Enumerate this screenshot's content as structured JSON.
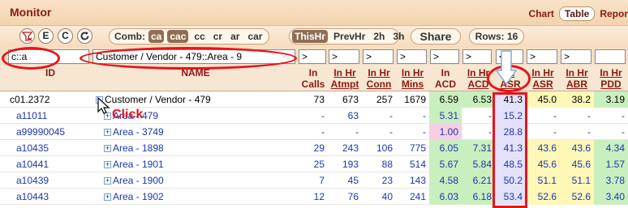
{
  "app": {
    "title": "Monitor",
    "links": [
      "Chart",
      "Table",
      "Repor"
    ]
  },
  "toolbar": {
    "icons": [
      "filter-clear-icon",
      "E",
      "C",
      "refresh-icon"
    ],
    "comb_label": "Comb:",
    "comb_options": [
      "ca",
      "cac",
      "cc",
      "cr",
      "ar",
      "car"
    ],
    "comb_selected": [
      "ca",
      "cac"
    ],
    "period_options": [
      "ThisHr",
      "PrevHr",
      "2h",
      "3h"
    ],
    "period_selected": "ThisHr",
    "share": "Share",
    "rows": "Rows: 16"
  },
  "filters": {
    "id": "c::a",
    "name": "Customer / Vendor - 479::Area - 9",
    "in_calls": ">",
    "in_hr_attempt": ">",
    "in_hr_conn": ">",
    "in_hr_mins": ">",
    "in_acd": ">",
    "in_hr_acd": ">",
    "in_asr": "<",
    "in_hr_asr": ">",
    "in_hr_abr": ">",
    "in_hr_pdd": ""
  },
  "columns": {
    "id": "ID",
    "name": "NAME",
    "in_calls": [
      "In",
      "Calls"
    ],
    "in_hr_attempt": [
      "In Hr",
      "Atmpt"
    ],
    "in_hr_conn": [
      "In Hr",
      "Conn"
    ],
    "in_hr_mins": [
      "In Hr",
      "Mins"
    ],
    "in_acd": [
      "In",
      "ACD"
    ],
    "in_hr_acd": [
      "In Hr",
      "ACD"
    ],
    "in_asr": [
      "In",
      "ASR"
    ],
    "in_hr_asr": [
      "In Hr",
      "ASR"
    ],
    "in_hr_abr": [
      "In Hr",
      "ABR"
    ],
    "in_hr_pdd": [
      "In Hr",
      "PDD"
    ]
  },
  "annotation": {
    "click": "Click"
  },
  "rows": [
    {
      "id": "c01.2372",
      "name": "Customer / Vendor - 479",
      "calls": "73",
      "attempt": "673",
      "conn": "257",
      "mins": "1679",
      "acd": "6.59",
      "hracd": "6.53",
      "asr": "41.3",
      "hrasr": "45.0",
      "abr": "38.2",
      "pdd": "3.19"
    },
    {
      "id": "a11011",
      "name": "Area - 479",
      "calls": "-",
      "attempt": "63",
      "conn": "-",
      "mins": "-",
      "acd": "5.31",
      "hracd": "-",
      "asr": "15.2",
      "hrasr": "-",
      "abr": "-",
      "pdd": "-"
    },
    {
      "id": "a99990045",
      "name": "Area - 3749",
      "calls": "-",
      "attempt": "-",
      "conn": "-",
      "mins": "-",
      "acd": "1.00",
      "hracd": "-",
      "asr": "28.8",
      "hrasr": "-",
      "abr": "-",
      "pdd": "-"
    },
    {
      "id": "a10435",
      "name": "Area - 1898",
      "calls": "29",
      "attempt": "243",
      "conn": "106",
      "mins": "775",
      "acd": "6.05",
      "hracd": "7.31",
      "asr": "41.3",
      "hrasr": "43.6",
      "abr": "43.6",
      "pdd": "4.34"
    },
    {
      "id": "a10441",
      "name": "Area - 1901",
      "calls": "25",
      "attempt": "193",
      "conn": "88",
      "mins": "514",
      "acd": "5.67",
      "hracd": "5.84",
      "asr": "48.5",
      "hrasr": "45.6",
      "abr": "45.6",
      "pdd": "1.57"
    },
    {
      "id": "a10439",
      "name": "Area - 1900",
      "calls": "7",
      "attempt": "45",
      "conn": "23",
      "mins": "143",
      "acd": "4.58",
      "hracd": "6.21",
      "asr": "50.2",
      "hrasr": "51.1",
      "abr": "51.1",
      "pdd": "3.78"
    },
    {
      "id": "a10443",
      "name": "Area - 1902",
      "calls": "12",
      "attempt": "76",
      "conn": "40",
      "mins": "241",
      "acd": "6.03",
      "hracd": "6.18",
      "asr": "53.4",
      "hrasr": "52.6",
      "abr": "52.6",
      "pdd": "3.40"
    }
  ],
  "colors": {
    "accent": "#8b1a10",
    "green": "#c9efbf",
    "yellow": "#fff7b8",
    "pink": "#f6cfe6",
    "lav": "#e4e2fb",
    "annotation": "#e8141a"
  }
}
